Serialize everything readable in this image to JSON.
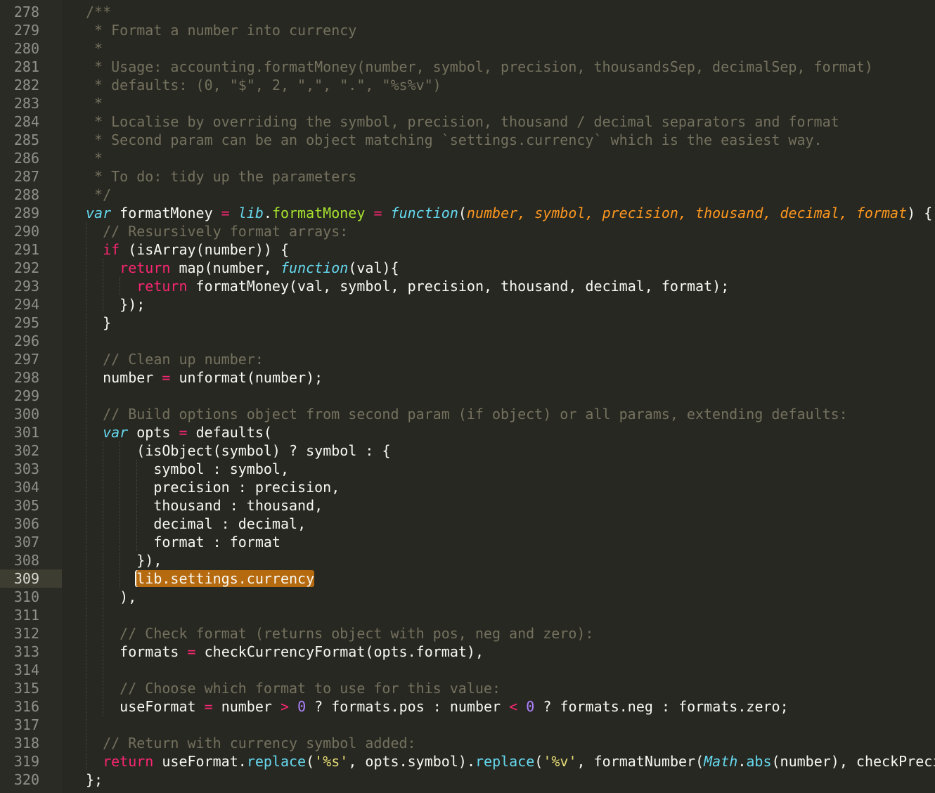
{
  "editor": {
    "colors": {
      "background": "#272822",
      "comment": "#75715e",
      "keyword": "#f92672",
      "storage": "#66d9ef",
      "function_name": "#a6e22e",
      "parameter": "#fd971f",
      "number": "#ae81ff",
      "string": "#e6db74",
      "selection": "#b66a0f"
    },
    "current_line": "309",
    "selected_text": "lib.settings.currency",
    "lines": [
      {
        "n": "278",
        "t": "/**"
      },
      {
        "n": "279",
        "t": " * Format a number into currency"
      },
      {
        "n": "280",
        "t": " *"
      },
      {
        "n": "281",
        "t": " * Usage: accounting.formatMoney(number, symbol, precision, thousandsSep, decimalSep, format)"
      },
      {
        "n": "282",
        "t": " * defaults: (0, \"$\", 2, \",\", \".\", \"%s%v\")"
      },
      {
        "n": "283",
        "t": " *"
      },
      {
        "n": "284",
        "t": " * Localise by overriding the symbol, precision, thousand / decimal separators and format"
      },
      {
        "n": "285",
        "t": " * Second param can be an object matching `settings.currency` which is the easiest way."
      },
      {
        "n": "286",
        "t": " *"
      },
      {
        "n": "287",
        "t": " * To do: tidy up the parameters"
      },
      {
        "n": "288",
        "t": " */"
      },
      {
        "n": "289",
        "t": "var formatMoney = lib.formatMoney = function(number, symbol, precision, thousand, decimal, format) {"
      },
      {
        "n": "290",
        "t": "  // Resursively format arrays:"
      },
      {
        "n": "291",
        "t": "  if (isArray(number)) {"
      },
      {
        "n": "292",
        "t": "    return map(number, function(val){"
      },
      {
        "n": "293",
        "t": "      return formatMoney(val, symbol, precision, thousand, decimal, format);"
      },
      {
        "n": "294",
        "t": "    });"
      },
      {
        "n": "295",
        "t": "  }"
      },
      {
        "n": "296",
        "t": ""
      },
      {
        "n": "297",
        "t": "  // Clean up number:"
      },
      {
        "n": "298",
        "t": "  number = unformat(number);"
      },
      {
        "n": "299",
        "t": ""
      },
      {
        "n": "300",
        "t": "  // Build options object from second param (if object) or all params, extending defaults:"
      },
      {
        "n": "301",
        "t": "  var opts = defaults("
      },
      {
        "n": "302",
        "t": "      (isObject(symbol) ? symbol : {"
      },
      {
        "n": "303",
        "t": "        symbol : symbol,"
      },
      {
        "n": "304",
        "t": "        precision : precision,"
      },
      {
        "n": "305",
        "t": "        thousand : thousand,"
      },
      {
        "n": "306",
        "t": "        decimal : decimal,"
      },
      {
        "n": "307",
        "t": "        format : format"
      },
      {
        "n": "308",
        "t": "      }),"
      },
      {
        "n": "309",
        "t": "      lib.settings.currency"
      },
      {
        "n": "310",
        "t": "    ),"
      },
      {
        "n": "311",
        "t": ""
      },
      {
        "n": "312",
        "t": "    // Check format (returns object with pos, neg and zero):"
      },
      {
        "n": "313",
        "t": "    formats = checkCurrencyFormat(opts.format),"
      },
      {
        "n": "314",
        "t": ""
      },
      {
        "n": "315",
        "t": "    // Choose which format to use for this value:"
      },
      {
        "n": "316",
        "t": "    useFormat = number > 0 ? formats.pos : number < 0 ? formats.neg : formats.zero;"
      },
      {
        "n": "317",
        "t": ""
      },
      {
        "n": "318",
        "t": "  // Return with currency symbol added:"
      },
      {
        "n": "319",
        "t": "  return useFormat.replace('%s', opts.symbol).replace('%v', formatNumber(Math.abs(number), checkPreci"
      },
      {
        "n": "320",
        "t": "};"
      }
    ]
  }
}
